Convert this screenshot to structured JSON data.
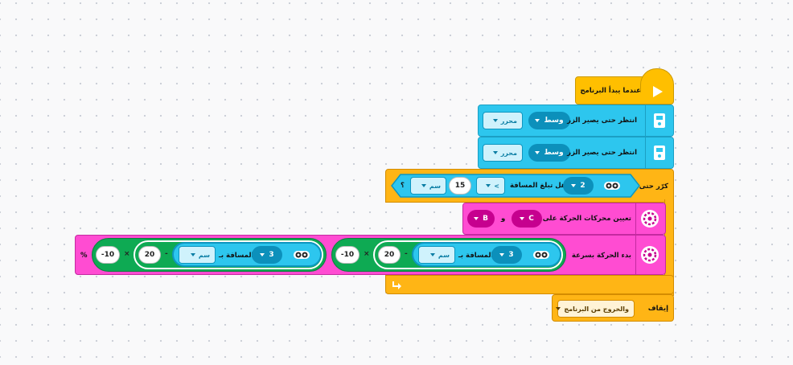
{
  "program": {
    "start_block": {
      "label": "عندما يبدأ البرنامج"
    },
    "wait_blocks": [
      {
        "label": "انتظر حتى يصير الزر",
        "button": "وسط",
        "state": "محرر"
      },
      {
        "label": "انتظر حتى يصير الزر",
        "button": "وسط",
        "state": "محرر"
      }
    ],
    "repeat_until": {
      "label": "كرّر حتى",
      "sensor_port": "2",
      "question": "هل تبلغ المسافة",
      "comparator": "<",
      "value": "15",
      "unit": "سم",
      "question_mark": "؟"
    },
    "set_motors": {
      "label": "تعيين محركات الحركة على",
      "port_a": "C",
      "and": "و",
      "port_b": "B"
    },
    "start_moving": {
      "label": "بدء الحركة بسرعة",
      "left_expr": {
        "sensor_port": "3",
        "distance_label": "المسافة بـ",
        "unit": "سم",
        "minus": "-",
        "subtract": "20",
        "times": "×",
        "factor": "-10"
      },
      "right_expr": {
        "sensor_port": "3",
        "distance_label": "المسافة بـ",
        "unit": "سم",
        "minus": "-",
        "subtract": "20",
        "times": "×",
        "factor": "-10"
      },
      "percent": "%"
    },
    "stop_block": {
      "label": "إيقاف",
      "option": "والخروج من البرنامج"
    }
  },
  "colors": {
    "events": "#ffbf00",
    "sensors": "#2dc6ee",
    "control": "#ffb515",
    "movement": "#ff4cd2",
    "operators": "#0eaa53"
  },
  "icons": [
    "play-icon",
    "hub-button-icon",
    "ultrasonic-sensor-icon",
    "movement-wheel-icon",
    "loop-arrow-icon",
    "dropdown-arrow-icon"
  ]
}
